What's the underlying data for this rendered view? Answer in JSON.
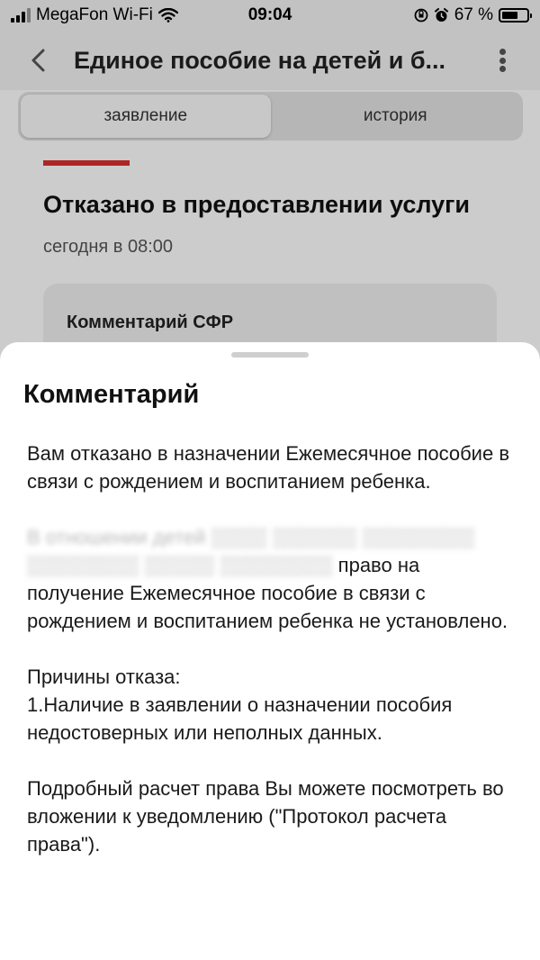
{
  "status_bar": {
    "carrier": "MegaFon Wi-Fi",
    "time": "09:04",
    "battery": "67 %",
    "battery_level": 0.67
  },
  "header": {
    "title": "Единое пособие на детей и б..."
  },
  "tabs": [
    {
      "label": "заявление",
      "active": true
    },
    {
      "label": "история",
      "active": false
    }
  ],
  "status_card": {
    "title": "Отказано в предоставлении услуги",
    "time": "сегодня в 08:00",
    "comment_box_title": "Комментарий СФР",
    "accent_color": "#d9302c"
  },
  "sheet": {
    "title": "Комментарий",
    "paragraphs": [
      "Вам отказано в назначении Ежемесячное пособие в связи с рождением и воспитанием ребенка.",
      "право на получение Ежемесячное пособие в связи с рождением и воспитанием ребенка не установлено.",
      "Причины отказа:",
      "1.Наличие в заявлении о назначении пособия недостоверных или неполных данных.",
      "Подробный расчет права Вы можете посмотреть во вложении к уведомлению (\"Протокол расчета права\")."
    ],
    "redacted_lead": "В отношении детей"
  }
}
